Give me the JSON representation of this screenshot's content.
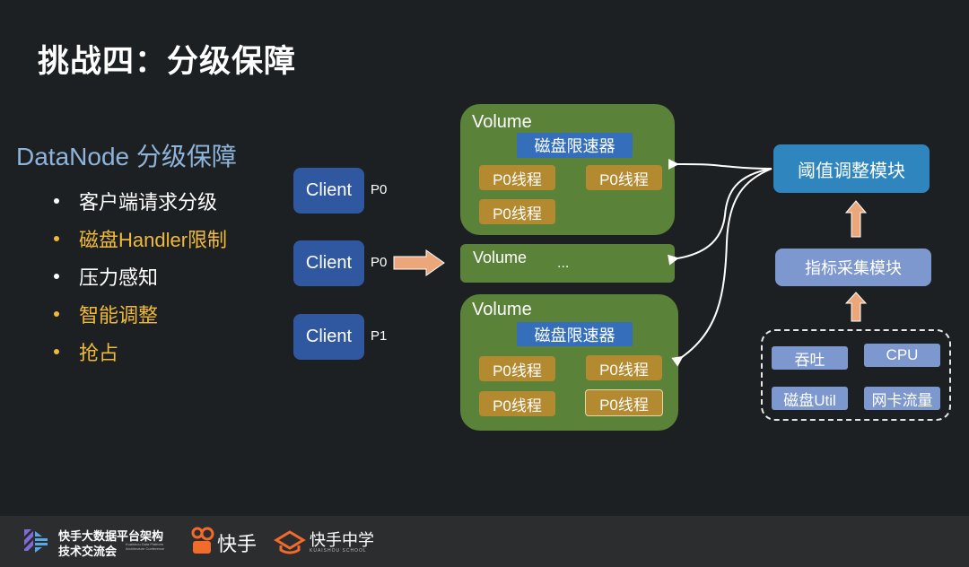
{
  "title": "挑战四：分级保障",
  "subtitle": "DataNode 分级保障",
  "bullets": [
    {
      "text": "客户端请求分级",
      "color": "#ffffff"
    },
    {
      "text": "磁盘Handler限制",
      "color": "#f0b93a"
    },
    {
      "text": "压力感知",
      "color": "#ffffff"
    },
    {
      "text": "智能调整",
      "color": "#f0b93a"
    },
    {
      "text": "抢占",
      "color": "#f0b93a"
    }
  ],
  "clients": [
    {
      "label": "Client",
      "priority": "P0"
    },
    {
      "label": "Client",
      "priority": "P0"
    },
    {
      "label": "Client",
      "priority": "P1"
    }
  ],
  "volumes": [
    {
      "label": "Volume",
      "limiter": "磁盘限速器",
      "threads": [
        "P0线程",
        "P0线程",
        "P0线程"
      ]
    },
    {
      "label": "Volume",
      "ellipsis": "..."
    },
    {
      "label": "Volume",
      "limiter": "磁盘限速器",
      "threads": [
        "P0线程",
        "P0线程",
        "P0线程",
        "P0线程"
      ]
    }
  ],
  "modules": {
    "threshold": "阈值调整模块",
    "metrics_collect": "指标采集模块"
  },
  "metrics": [
    "吞吐",
    "CPU",
    "磁盘Util",
    "网卡流量"
  ],
  "footer": {
    "conf_line1": "快手大数据平台架构",
    "conf_line2": "技术交流会",
    "conf_en1": "Kuaishou Data Platform",
    "conf_en2": "Architecture Conference",
    "brand": "快手",
    "school": "快手中学",
    "school_en": "KUAISHOU SCHOOL"
  },
  "colors": {
    "background": "#1d2022",
    "client": "#2f58a0",
    "volume": "#5b8239",
    "limiter": "#356fbb",
    "thread": "#b38a30",
    "threshold_module": "#2f86bf",
    "metrics_module": "#7d97cf",
    "arrow": "#eba77a",
    "accent_text": "#f0b93a",
    "subtitle": "#8fb4da"
  }
}
